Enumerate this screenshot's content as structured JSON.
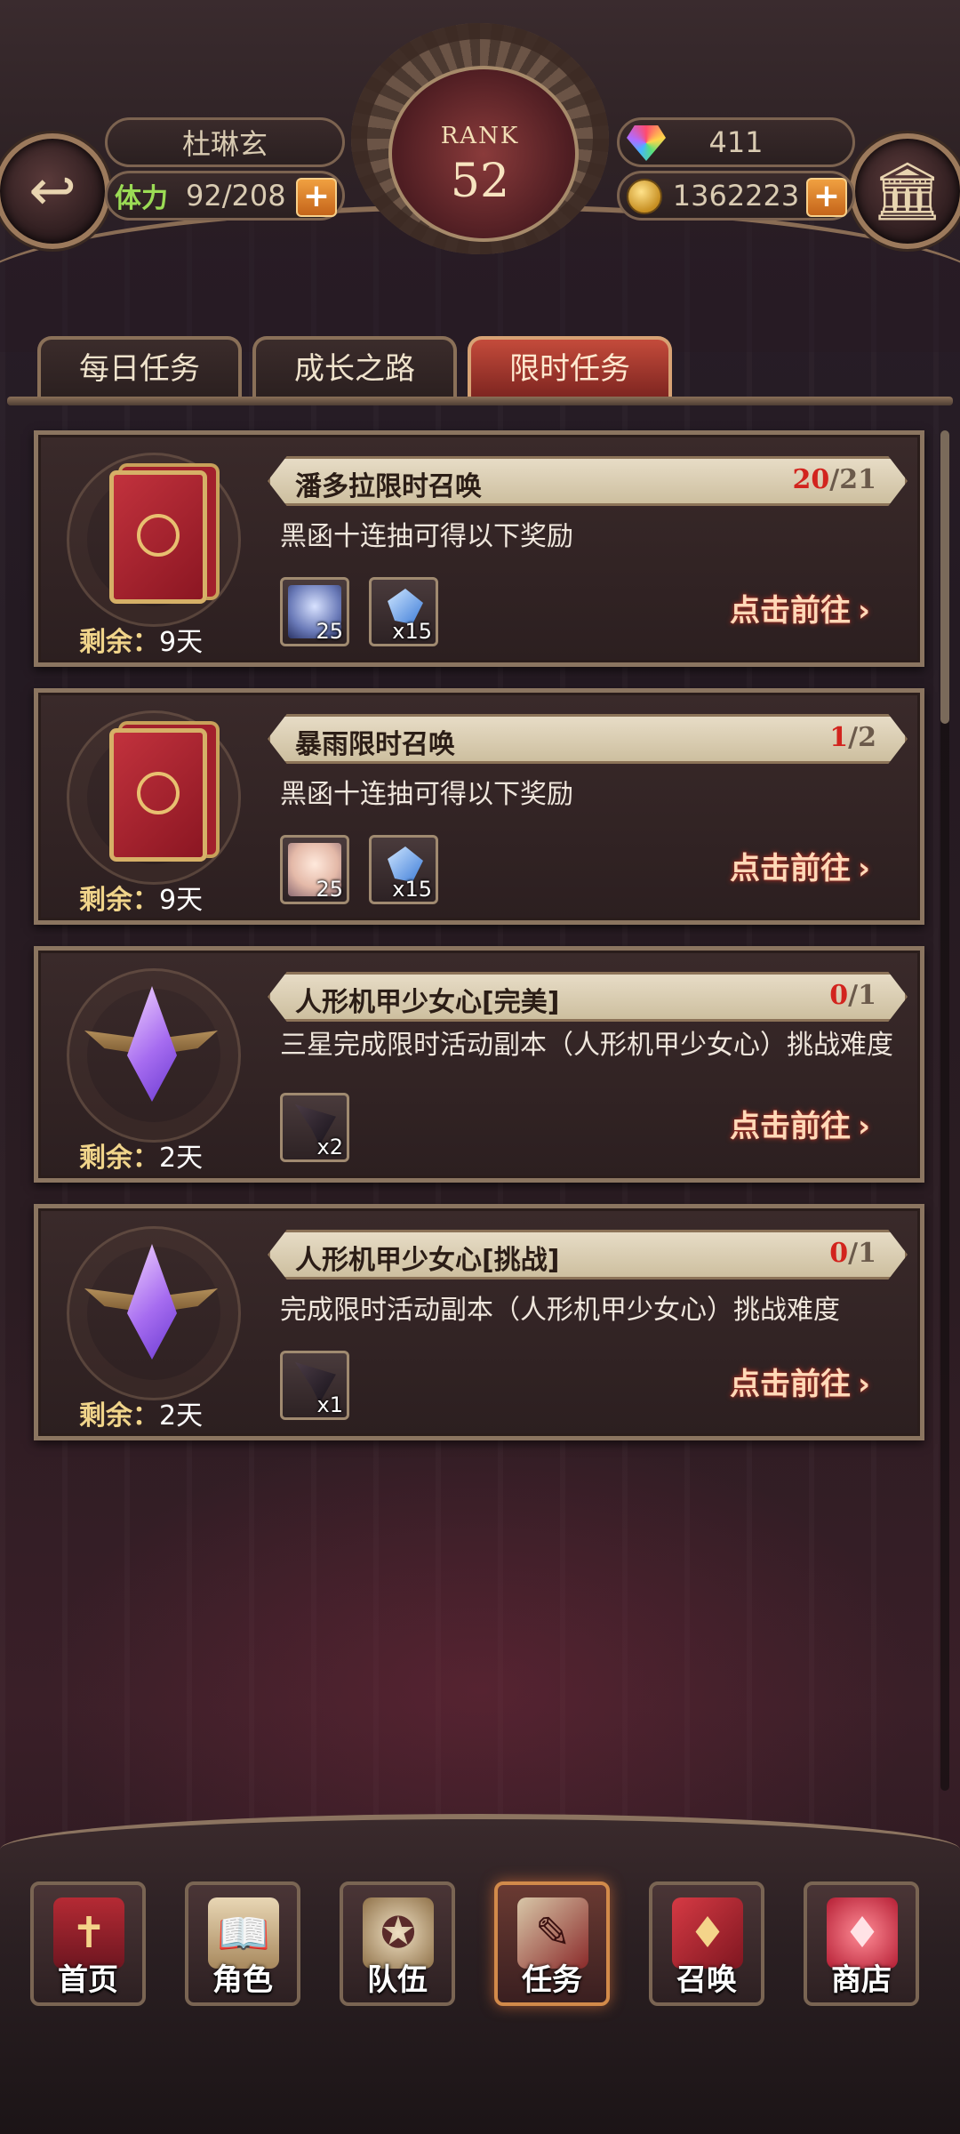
{
  "header": {
    "player_name": "杜琳玄",
    "stamina_label": "体力",
    "stamina_value": "92/208",
    "rank_label": "RANK",
    "rank_value": "52",
    "gems": "411",
    "gold": "1362223",
    "plus_symbol": "+"
  },
  "tabs": [
    {
      "label": "每日任务",
      "active": false
    },
    {
      "label": "成长之路",
      "active": false
    },
    {
      "label": "限时任务",
      "active": true
    }
  ],
  "tasks": [
    {
      "title": "潘多拉限时召唤",
      "progress_current": "20",
      "progress_total": "/21",
      "description": "黑函十连抽可得以下奖励",
      "remaining_label": "剩余：",
      "remaining_value": "9天",
      "goto_label": "点击前往",
      "rewards": [
        {
          "count": "25",
          "icon": "hero-portrait-icon"
        },
        {
          "count": "x15",
          "icon": "crystal-ore-icon"
        }
      ]
    },
    {
      "title": "暴雨限时召唤",
      "progress_current": "1",
      "progress_total": "/2",
      "description": "黑函十连抽可得以下奖励",
      "remaining_label": "剩余：",
      "remaining_value": "9天",
      "goto_label": "点击前往",
      "rewards": [
        {
          "count": "25",
          "icon": "hero-portrait-icon"
        },
        {
          "count": "x15",
          "icon": "crystal-ore-icon"
        }
      ]
    },
    {
      "title": "人形机甲少女心[完美]",
      "progress_current": "0",
      "progress_total": "/1",
      "description": "三星完成限时活动副本（人形机甲少女心）挑战难度",
      "remaining_label": "剩余：",
      "remaining_value": "2天",
      "goto_label": "点击前往",
      "rewards": [
        {
          "count": "x2",
          "icon": "dark-wing-icon"
        }
      ]
    },
    {
      "title": "人形机甲少女心[挑战]",
      "progress_current": "0",
      "progress_total": "/1",
      "description": "完成限时活动副本（人形机甲少女心）挑战难度",
      "remaining_label": "剩余：",
      "remaining_value": "2天",
      "goto_label": "点击前往",
      "rewards": [
        {
          "count": "x1",
          "icon": "dark-wing-icon"
        }
      ]
    }
  ],
  "goto_arrow": "›",
  "bottom_nav": [
    {
      "label": "首页",
      "icon": "home-banner-icon",
      "active": false
    },
    {
      "label": "角色",
      "icon": "character-book-icon",
      "active": false
    },
    {
      "label": "队伍",
      "icon": "team-crest-icon",
      "active": false
    },
    {
      "label": "任务",
      "icon": "quest-book-icon",
      "active": true
    },
    {
      "label": "召唤",
      "icon": "summon-card-icon",
      "active": false
    },
    {
      "label": "商店",
      "icon": "shop-gem-icon",
      "active": false
    }
  ],
  "colors": {
    "accent_red": "#d2241e",
    "goto_glow": "#c2392c",
    "gold_text": "#f0d48a",
    "stamina_green": "#9bdc55"
  }
}
